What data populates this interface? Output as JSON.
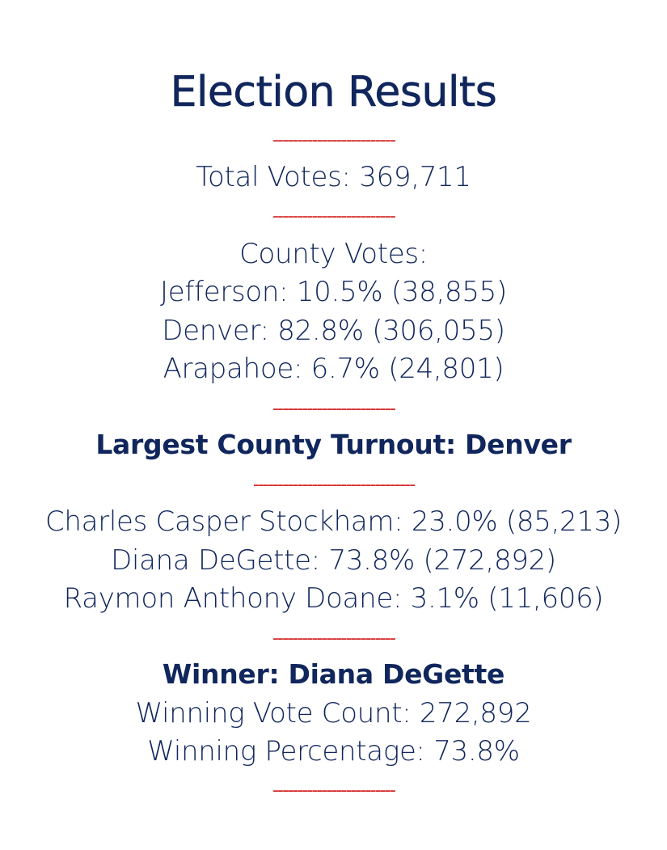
{
  "title": "Election Results",
  "divider_short": "-------------------------",
  "divider_long": "---------------------------------",
  "total_votes": "Total Votes: 369,711",
  "county_votes": {
    "heading": "County Votes:",
    "rows": [
      "Jefferson: 10.5% (38,855)",
      "Denver: 82.8% (306,055)",
      "Arapahoe: 6.7% (24,801)"
    ]
  },
  "largest_county": "Largest County Turnout: Denver",
  "candidates": [
    "Charles Casper Stockham: 23.0% (85,213)",
    "Diana DeGette: 73.8% (272,892)",
    "Raymon Anthony Doane: 3.1% (11,606)"
  ],
  "winner": {
    "name_line": "Winner: Diana DeGette",
    "vote_count_line": "Winning Vote Count: 272,892",
    "percentage_line": "Winning Percentage: 73.8%"
  },
  "colors": {
    "text": "#10265c",
    "divider": "#d52a2a",
    "background": "#ffffff"
  }
}
